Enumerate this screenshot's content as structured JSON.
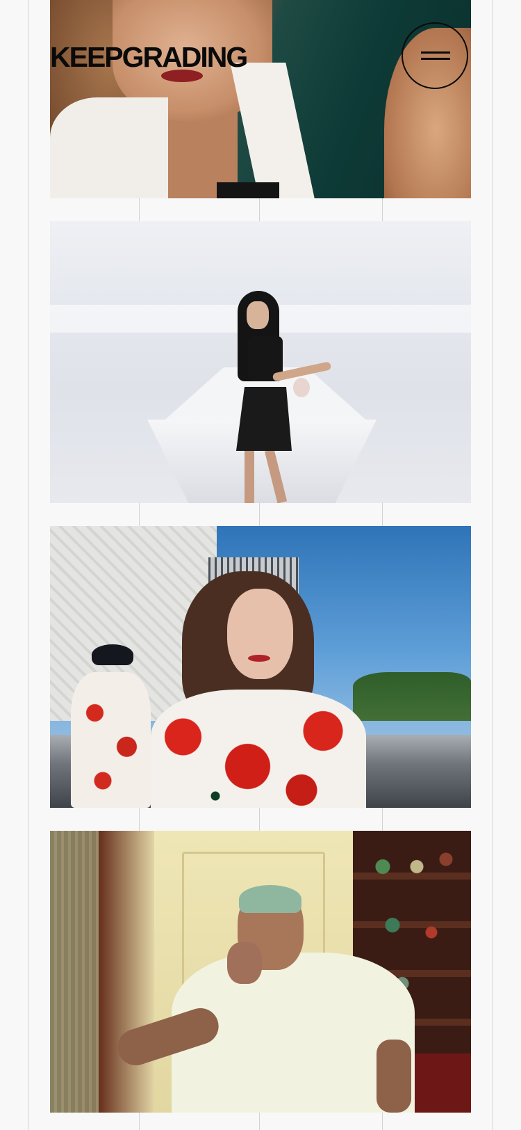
{
  "header": {
    "logo_text": "KEEPGRADING",
    "menu_icon": "hamburger-menu-icon"
  },
  "gallery": {
    "items": [
      {
        "id": "woman-white-blazer-by-water"
      },
      {
        "id": "model-white-room-ping-pong"
      },
      {
        "id": "rooftop-red-poppy-shirts"
      },
      {
        "id": "man-white-tee-smoking"
      }
    ]
  }
}
